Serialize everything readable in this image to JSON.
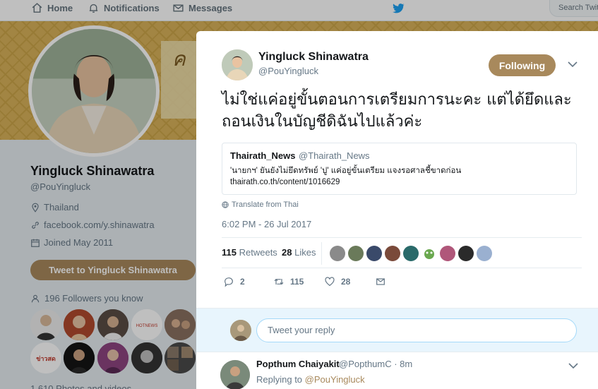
{
  "nav": {
    "home": "Home",
    "notifications": "Notifications",
    "messages": "Messages",
    "search_placeholder": "Search Twitter"
  },
  "profile": {
    "name": "Yingluck Shinawatra",
    "handle": "@PouYingluck",
    "location": "Thailand",
    "website": "facebook.com/y.shinawatra",
    "joined": "Joined May 2011",
    "tweet_to_label": "Tweet to Yingluck Shinawatra",
    "followers_you_know": "196 Followers you know",
    "photos_videos": "1,610 Photos and videos"
  },
  "tweet": {
    "author_name": "Yingluck Shinawatra",
    "author_handle": "@PouYingluck",
    "follow_label": "Following",
    "text": "ไม่ใช่แค่อยู่ขั้นตอนการเตรียมการนะคะ แต่ได้ยึดและถอนเงินในบัญชีดิฉันไปแล้วค่ะ",
    "quote": {
      "name": "Thairath_News",
      "handle": "@Thairath_News",
      "text": "'นายกฯ' ยันยังไม่ยึดทรัพย์ 'ปู' แค่อยู่ขั้นเตรียม แจงรอศาลชี้ขาดก่อน",
      "link": "thairath.co.th/content/1016629"
    },
    "translate_label": "Translate from Thai",
    "timestamp": "6:02 PM - 26 Jul 2017",
    "retweets_count": "115",
    "retweets_label": "Retweets",
    "likes_count": "28",
    "likes_label": "Likes",
    "actions": {
      "replies": "2",
      "retweets": "115",
      "likes": "28"
    }
  },
  "reply_box": {
    "placeholder": "Tweet your reply"
  },
  "reply": {
    "name": "Popthum Chaiyakit",
    "handle_time": "@PopthumC · 8m",
    "replying_prefix": "Replying to",
    "replying_to": "@PouYingluck"
  },
  "colors": {
    "theme": "#a8895c",
    "banner": "#d8b25a",
    "twitter_blue": "#1da1f2"
  }
}
